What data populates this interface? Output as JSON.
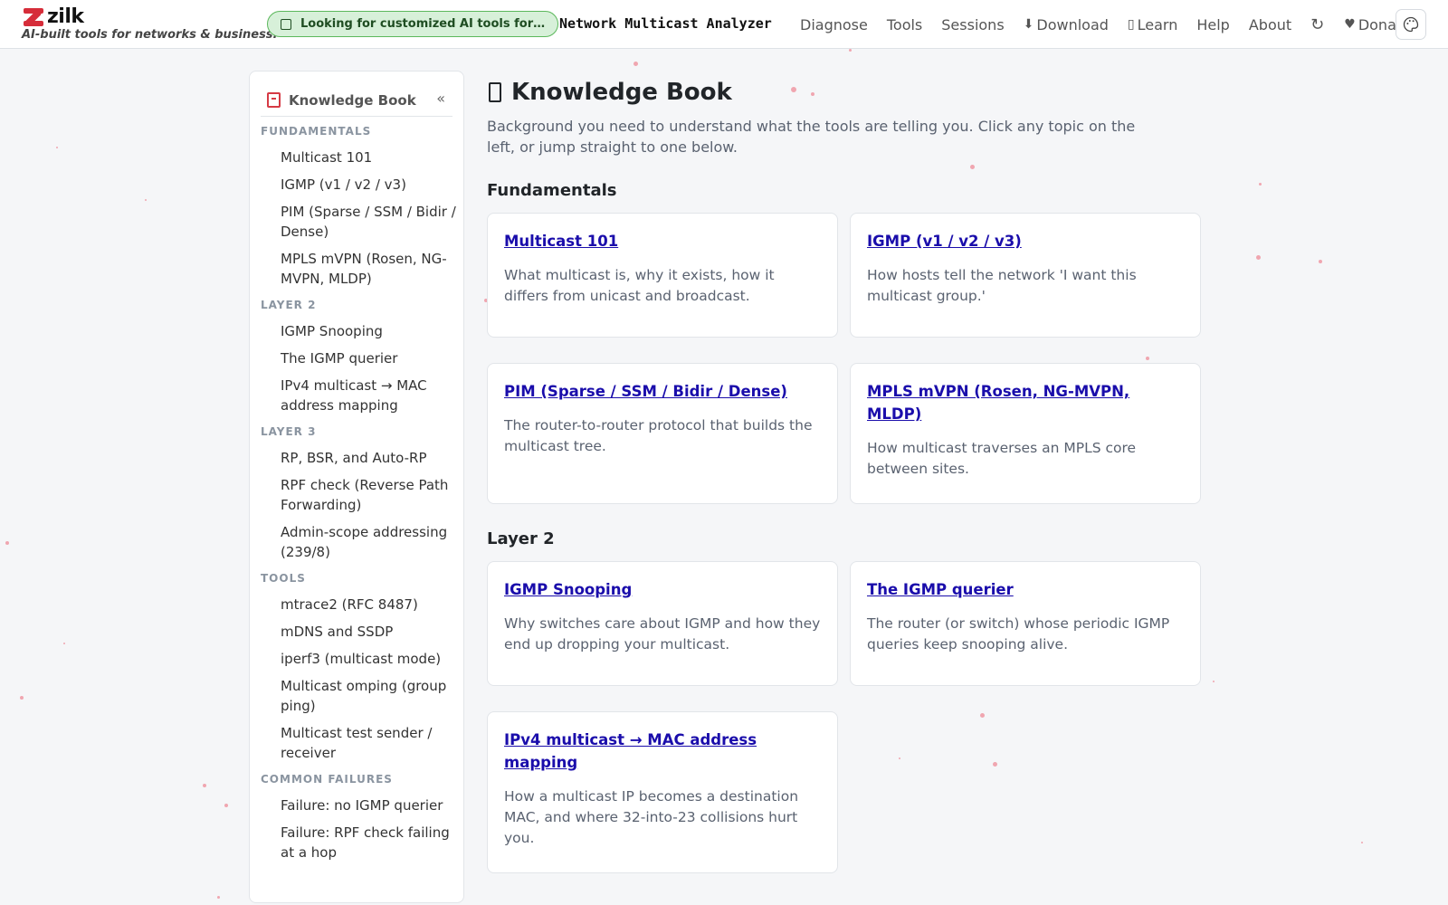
{
  "header": {
    "brand": "zilk",
    "tagline": "AI-built tools for networks & business.",
    "promo": "Looking for customized AI tools for y…",
    "app_title": "Network Multicast Analyzer",
    "nav": [
      {
        "label": "Diagnose",
        "icon": ""
      },
      {
        "label": "Tools",
        "icon": ""
      },
      {
        "label": "Sessions",
        "icon": ""
      },
      {
        "label": "Download",
        "icon": "⬇"
      },
      {
        "label": "Learn",
        "icon": "▯"
      },
      {
        "label": "Help",
        "icon": ""
      },
      {
        "label": "About",
        "icon": ""
      }
    ],
    "refresh_icon": "↻",
    "donate": {
      "label": "Donate",
      "icon": "♥"
    },
    "theme_icon": "palette-icon"
  },
  "sidebar": {
    "title": "Knowledge Book",
    "collapse": "«",
    "sections": [
      {
        "title": "FUNDAMENTALS",
        "items": [
          "Multicast 101",
          "IGMP (v1 / v2 / v3)",
          "PIM (Sparse / SSM / Bidir / Dense)",
          "MPLS mVPN (Rosen, NG-MVPN, MLDP)"
        ]
      },
      {
        "title": "LAYER 2",
        "items": [
          "IGMP Snooping",
          "The IGMP querier",
          "IPv4 multicast → MAC address mapping"
        ]
      },
      {
        "title": "LAYER 3",
        "items": [
          "RP, BSR, and Auto-RP",
          "RPF check (Reverse Path Forwarding)",
          "Admin-scope addressing (239/8)"
        ]
      },
      {
        "title": "TOOLS",
        "items": [
          "mtrace2 (RFC 8487)",
          "mDNS and SSDP",
          "iperf3 (multicast mode)",
          "Multicast omping (group ping)",
          "Multicast test sender / receiver"
        ]
      },
      {
        "title": "COMMON FAILURES",
        "items": [
          "Failure: no IGMP querier",
          "Failure: RPF check failing at a hop"
        ]
      }
    ]
  },
  "main": {
    "title": "Knowledge Book",
    "intro": "Background you need to understand what the tools are telling you. Click any topic on the left, or jump straight to one below.",
    "sections": [
      {
        "title": "Fundamentals",
        "cards": [
          {
            "title": "Multicast 101",
            "desc": "What multicast is, why it exists, how it differs from unicast and broadcast."
          },
          {
            "title": "IGMP (v1 / v2 / v3)",
            "desc": "How hosts tell the network 'I want this multicast group.'"
          },
          {
            "title": "PIM (Sparse / SSM / Bidir / Dense)",
            "desc": "The router-to-router protocol that builds the multicast tree."
          },
          {
            "title": "MPLS mVPN (Rosen, NG-MVPN, MLDP)",
            "desc": "How multicast traverses an MPLS core between sites."
          }
        ]
      },
      {
        "title": "Layer 2",
        "cards": [
          {
            "title": "IGMP Snooping",
            "desc": "Why switches care about IGMP and how they end up dropping your multicast."
          },
          {
            "title": "The IGMP querier",
            "desc": "The router (or switch) whose periodic IGMP queries keep snooping alive."
          },
          {
            "title": "IPv4 multicast → MAC address mapping",
            "desc": "How a multicast IP becomes a destination MAC, and where 32-into-23 collisions hurt you."
          }
        ]
      }
    ]
  },
  "colors": {
    "brand": "#d62d3a",
    "link": "#1a0dab",
    "promo_bg": "#d7f0d9",
    "promo_border": "#5cb85c"
  }
}
